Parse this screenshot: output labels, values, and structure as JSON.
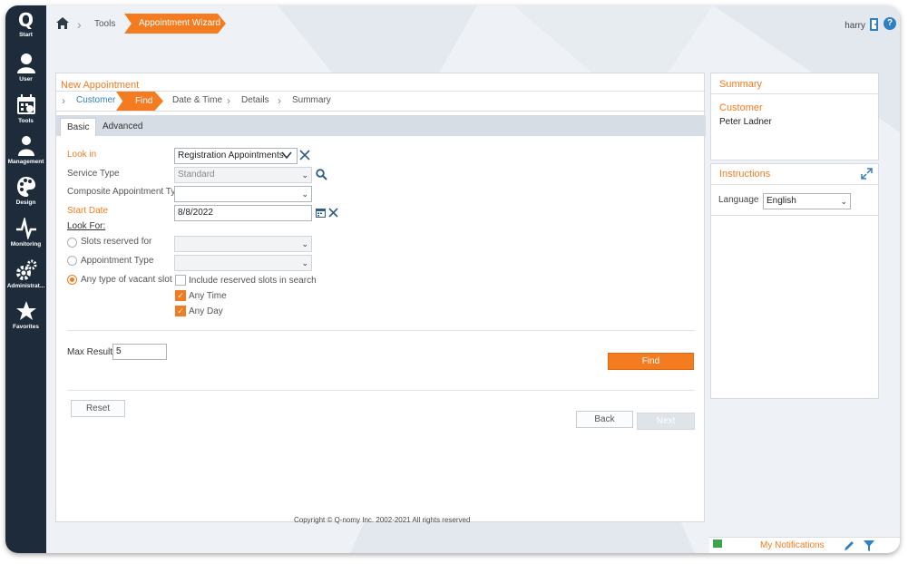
{
  "sidebar": {
    "logo": "Q",
    "logo_sub": "Start",
    "items": [
      {
        "label": "User",
        "icon": "user-icon"
      },
      {
        "label": "Tools",
        "icon": "calendar-tools-icon"
      },
      {
        "label": "Management",
        "icon": "management-icon"
      },
      {
        "label": "Design",
        "icon": "palette-icon"
      },
      {
        "label": "Monitoring",
        "icon": "pulse-icon"
      },
      {
        "label": "Administrat...",
        "icon": "gears-icon"
      },
      {
        "label": "Favorites",
        "icon": "star-icon"
      }
    ]
  },
  "header": {
    "breadcrumb_tools": "Tools",
    "breadcrumb_active": "Appointment Wizard",
    "user": "harry",
    "help": "?"
  },
  "wizard": {
    "title": "New Appointment",
    "steps": {
      "customer": "Customer",
      "find": "Find",
      "datetime": "Date & Time",
      "details": "Details",
      "summary": "Summary"
    },
    "tabs": {
      "basic": "Basic",
      "advanced": "Advanced"
    }
  },
  "form": {
    "look_in_label": "Look in",
    "look_in_value": "Registration Appointments",
    "service_type_label": "Service Type",
    "service_type_value": "Standard",
    "composite_label": "Composite Appointment Type",
    "composite_value": "",
    "start_date_label": "Start Date",
    "start_date_value": "8/8/2022",
    "look_for_label": "Look For:",
    "radio_slots": "Slots reserved for",
    "radio_appt": "Appointment Type",
    "radio_any": "Any type of vacant slot",
    "include_reserved": "Include reserved slots in search",
    "any_time": "Any Time",
    "any_day": "Any Day",
    "max_results_label": "Max Results",
    "max_results_value": "5",
    "find_button": "Find",
    "reset_button": "Reset",
    "back_button": "Back",
    "next_button": "Next"
  },
  "summary": {
    "title": "Summary",
    "customer_label": "Customer",
    "customer_name": "Peter Ladner"
  },
  "instructions": {
    "title": "Instructions",
    "language_label": "Language",
    "language_value": "English"
  },
  "footer": {
    "copyright": "Copyright © Q-nomy Inc. 2002-2021 All rights reserved",
    "notifications": "My Notifications"
  },
  "colors": {
    "accent": "#f47b20",
    "sidebar": "#1d2b3a",
    "link": "#2f7fc1"
  }
}
